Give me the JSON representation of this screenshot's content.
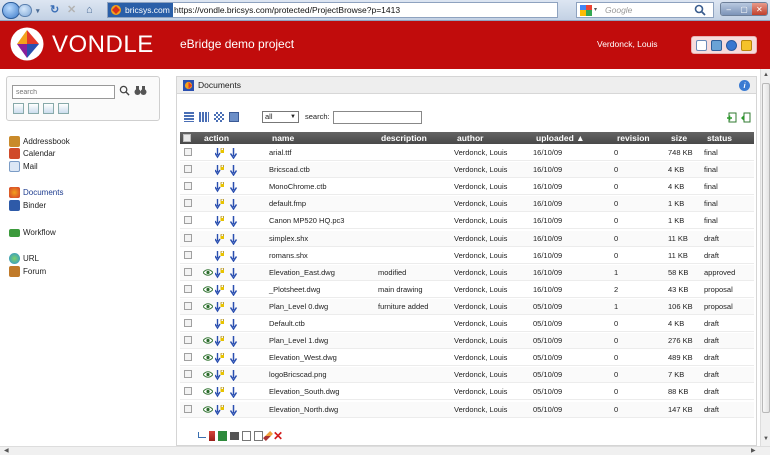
{
  "browser": {
    "site_badge": "bricsys.com",
    "url": "https://vondle.bricsys.com/protected/ProjectBrowse?p=1413",
    "search_placeholder": "Google"
  },
  "header": {
    "logo": "VONDLE",
    "project_title": "eBridge demo project",
    "user_name": "Verdonck, Louis"
  },
  "sidebar": {
    "search_placeholder": "search",
    "items": [
      {
        "label": "Addressbook",
        "icon": "addressbook-icon",
        "color": "#c98a2a"
      },
      {
        "label": "Calendar",
        "icon": "calendar-icon",
        "color": "#d04a2a"
      },
      {
        "label": "Mail",
        "icon": "mail-icon",
        "color": "#7b9cc6"
      },
      {
        "label": "Documents",
        "icon": "documents-icon",
        "color": "#d23c2a",
        "active": true
      },
      {
        "label": "Binder",
        "icon": "binder-icon",
        "color": "#2e5aa8"
      },
      {
        "label": "Workflow",
        "icon": "workflow-icon",
        "color": "#3c9a3c"
      },
      {
        "label": "URL",
        "icon": "globe-icon",
        "color": "#2a8fd6"
      },
      {
        "label": "Forum",
        "icon": "forum-icon",
        "color": "#c07a2a"
      }
    ]
  },
  "main": {
    "panel_title": "Documents",
    "filter_value": "all",
    "search_label": "search:",
    "columns": {
      "action": "action",
      "name": "name",
      "description": "description",
      "author": "author",
      "uploaded": "uploaded ▲",
      "revision": "revision",
      "size": "size",
      "status": "status"
    },
    "rows": [
      {
        "eye": false,
        "name": "arial.ttf",
        "description": "",
        "author": "Verdonck, Louis",
        "uploaded": "16/10/09",
        "revision": "0",
        "size": "748 KB",
        "status": "final"
      },
      {
        "eye": false,
        "name": "Bricscad.ctb",
        "description": "",
        "author": "Verdonck, Louis",
        "uploaded": "16/10/09",
        "revision": "0",
        "size": "4 KB",
        "status": "final"
      },
      {
        "eye": false,
        "name": "MonoChrome.ctb",
        "description": "",
        "author": "Verdonck, Louis",
        "uploaded": "16/10/09",
        "revision": "0",
        "size": "4 KB",
        "status": "final"
      },
      {
        "eye": false,
        "name": "default.fmp",
        "description": "",
        "author": "Verdonck, Louis",
        "uploaded": "16/10/09",
        "revision": "0",
        "size": "1 KB",
        "status": "final"
      },
      {
        "eye": false,
        "name": "Canon MP520 HQ.pc3",
        "description": "",
        "author": "Verdonck, Louis",
        "uploaded": "16/10/09",
        "revision": "0",
        "size": "1 KB",
        "status": "final"
      },
      {
        "eye": false,
        "name": "simplex.shx",
        "description": "",
        "author": "Verdonck, Louis",
        "uploaded": "16/10/09",
        "revision": "0",
        "size": "11 KB",
        "status": "draft"
      },
      {
        "eye": false,
        "name": "romans.shx",
        "description": "",
        "author": "Verdonck, Louis",
        "uploaded": "16/10/09",
        "revision": "0",
        "size": "11 KB",
        "status": "draft"
      },
      {
        "eye": true,
        "name": "Elevation_East.dwg",
        "description": "modified",
        "author": "Verdonck, Louis",
        "uploaded": "16/10/09",
        "revision": "1",
        "size": "58 KB",
        "status": "approved"
      },
      {
        "eye": true,
        "name": "_Plotsheet.dwg",
        "description": "main drawing",
        "author": "Verdonck, Louis",
        "uploaded": "16/10/09",
        "revision": "2",
        "size": "43 KB",
        "status": "proposal"
      },
      {
        "eye": true,
        "name": "Plan_Level 0.dwg",
        "description": "furniture added",
        "author": "Verdonck, Louis",
        "uploaded": "05/10/09",
        "revision": "1",
        "size": "106 KB",
        "status": "proposal"
      },
      {
        "eye": false,
        "name": "Default.ctb",
        "description": "",
        "author": "Verdonck, Louis",
        "uploaded": "05/10/09",
        "revision": "0",
        "size": "4 KB",
        "status": "draft"
      },
      {
        "eye": true,
        "name": "Plan_Level 1.dwg",
        "description": "",
        "author": "Verdonck, Louis",
        "uploaded": "05/10/09",
        "revision": "0",
        "size": "276 KB",
        "status": "draft"
      },
      {
        "eye": true,
        "name": "Elevation_West.dwg",
        "description": "",
        "author": "Verdonck, Louis",
        "uploaded": "05/10/09",
        "revision": "0",
        "size": "489 KB",
        "status": "draft"
      },
      {
        "eye": true,
        "name": "logoBricscad.png",
        "description": "",
        "author": "Verdonck, Louis",
        "uploaded": "05/10/09",
        "revision": "0",
        "size": "7 KB",
        "status": "draft"
      },
      {
        "eye": true,
        "name": "Elevation_South.dwg",
        "description": "",
        "author": "Verdonck, Louis",
        "uploaded": "05/10/09",
        "revision": "0",
        "size": "88 KB",
        "status": "draft"
      },
      {
        "eye": true,
        "name": "Elevation_North.dwg",
        "description": "",
        "author": "Verdonck, Louis",
        "uploaded": "05/10/09",
        "revision": "0",
        "size": "147 KB",
        "status": "draft"
      }
    ]
  },
  "colors": {
    "header_red": "#c10c0c",
    "table_head": "#555555",
    "download_blue": "#2a4fb0",
    "lock_yellow": "#e8c300",
    "eye_green": "#3a7a3a"
  }
}
